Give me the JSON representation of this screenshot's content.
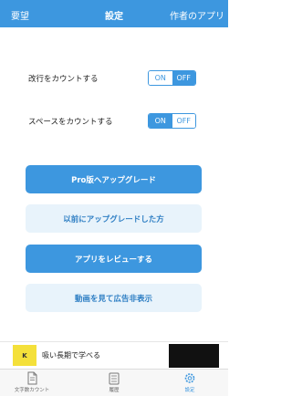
{
  "nav": {
    "left_label": "要望",
    "title": "設定",
    "right_label": "作者のアプリ"
  },
  "settings": [
    {
      "label": "改行をカウントする",
      "on_label": "ON",
      "off_label": "OFF",
      "selected": "OFF"
    },
    {
      "label": "スペースをカウントする",
      "on_label": "ON",
      "off_label": "OFF",
      "selected": "ON"
    }
  ],
  "buttons": {
    "pro_upgrade": "Pro版へアップグレード",
    "previously_upgraded": "以前にアップグレードした方",
    "review_app": "アプリをレビューする",
    "watch_video_remove_ads": "動画を見て広告非表示"
  },
  "ad": {
    "text": "吸い長期で学べる",
    "logo_text": "K"
  },
  "tabs": [
    {
      "label": "文字数カウント",
      "icon": "document-icon"
    },
    {
      "label": "履歴",
      "icon": "history-icon"
    },
    {
      "label": "設定",
      "icon": "gear-icon",
      "active": true
    }
  ],
  "colors": {
    "accent": "#3d97df",
    "secondary_button_bg": "#e8f3fb"
  }
}
